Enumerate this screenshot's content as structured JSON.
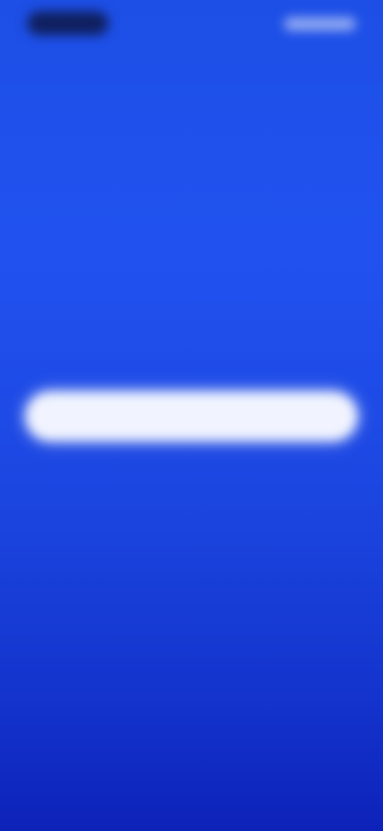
{
  "colors": {
    "background_top": "#1d4fe6",
    "background_bottom": "#0d22b8",
    "button_bg": "#f1f4ff",
    "status_pill": "#10205e"
  },
  "status_bar": {
    "left_icon": "status-pill-icon",
    "right_icon": "status-indicators-icon"
  },
  "header": {
    "caption": ""
  },
  "welcome": {
    "title": "",
    "subtitle": ""
  },
  "primary_button": {
    "label": ""
  }
}
